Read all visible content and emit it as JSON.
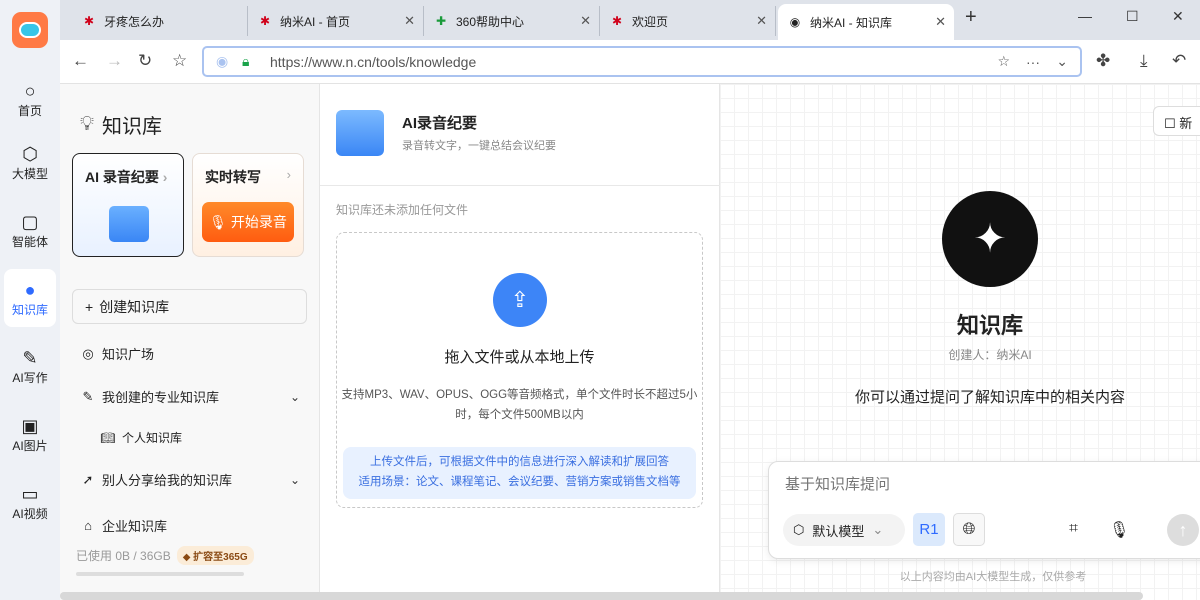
{
  "browser": {
    "tabs": [
      {
        "label": "牙疼怎么办"
      },
      {
        "label": "纳米AI - 首页"
      },
      {
        "label": "360帮助中心"
      },
      {
        "label": "欢迎页"
      },
      {
        "label": "纳米AI - 知识库"
      }
    ],
    "new_tab": "+",
    "url_host": "https://www.n.cn",
    "url_path": "/tools/knowledge"
  },
  "sidebar": {
    "items": [
      {
        "label": "首页",
        "icon": "search-icon"
      },
      {
        "label": "大模型",
        "icon": "cube-icon"
      },
      {
        "label": "智能体",
        "icon": "agent-icon"
      },
      {
        "label": "知识库",
        "icon": "knowledge-icon"
      },
      {
        "label": "AI写作",
        "icon": "pen-icon"
      },
      {
        "label": "AI图片",
        "icon": "image-icon"
      },
      {
        "label": "AI视频",
        "icon": "video-icon"
      }
    ]
  },
  "left": {
    "title": "知识库",
    "card1": "AI 录音纪要",
    "card2": "实时转写",
    "start_record": "开始录音",
    "create": "创建知识库",
    "plaza": "知识广场",
    "mine": "我创建的专业知识库",
    "personal": "个人知识库",
    "shared": "别人分享给我的知识库",
    "enterprise": "企业知识库",
    "usage": "已使用 0B / 36GB",
    "expand": "扩容至365G",
    "usage_fraction": 0
  },
  "middle": {
    "title": "AI录音纪要",
    "subtitle": "录音转文字，一键总结会议纪要",
    "empty": "知识库还未添加任何文件",
    "upload": "拖入文件或从本地上传",
    "formats": "支持MP3、WAV、OPUS、OGG等音频格式，单个文件时长不超过5小时，每个文件500MB以内",
    "tip1": "上传文件后，可根据文件中的信息进行深入解读和扩展回答",
    "tip2": "适用场景：论文、课程笔记、会议纪要、营销方案或销售文档等"
  },
  "right": {
    "new_btn": "新",
    "title": "知识库",
    "creator": "创建人：纳米AI",
    "desc": "你可以通过提问了解知识库中的相关内容",
    "placeholder": "基于知识库提问",
    "model": "默认模型",
    "r1": "R1",
    "disclaimer": "以上内容均由AI大模型生成，仅供参考"
  },
  "colors": {
    "accent": "#2f6bff",
    "orange": "#ff6a1a"
  }
}
